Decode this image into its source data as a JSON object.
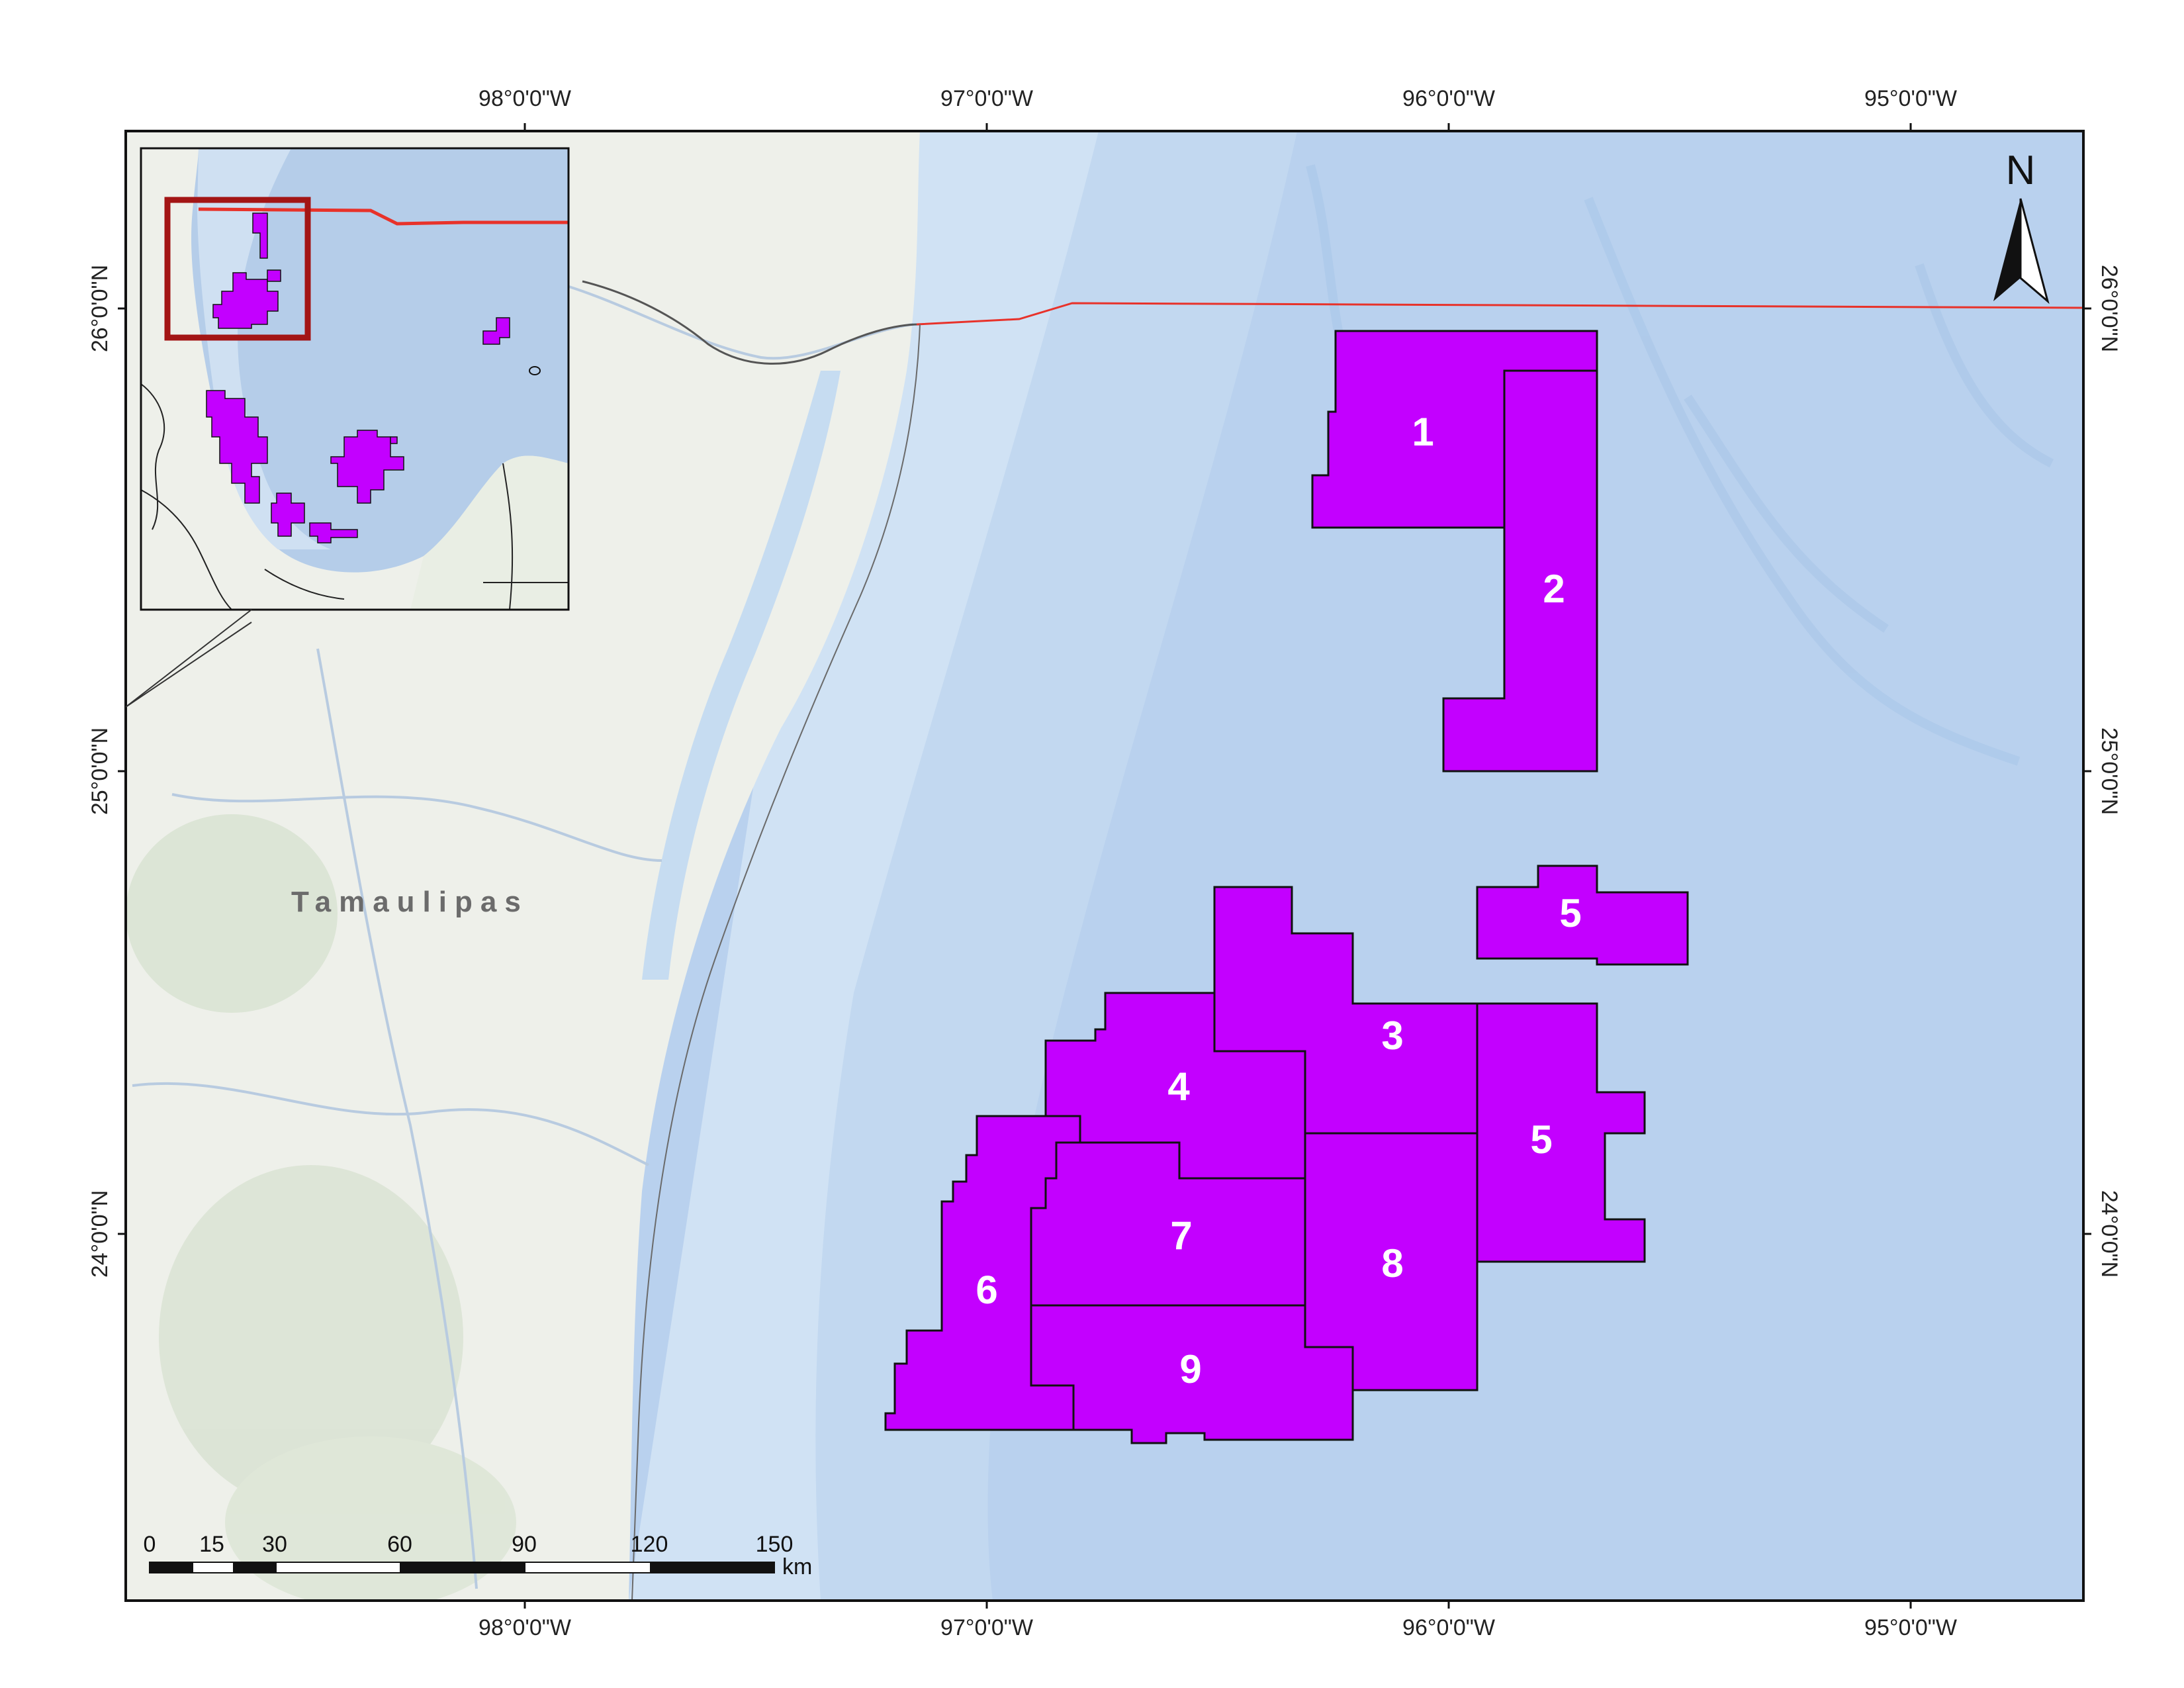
{
  "graticule": {
    "longitudes": [
      "98°0'0\"W",
      "97°0'0\"W",
      "96°0'0\"W",
      "95°0'0\"W"
    ],
    "latitudes": [
      "26°0'0\"N",
      "25°0'0\"N",
      "24°0'0\"N"
    ]
  },
  "place_labels": {
    "tamaulipas": "Tamaulipas"
  },
  "blocks": {
    "b1": "1",
    "b2": "2",
    "b3": "3",
    "b4": "4",
    "b5a": "5",
    "b5b": "5",
    "b6": "6",
    "b7": "7",
    "b8": "8",
    "b9": "9"
  },
  "scale_bar": {
    "ticks": [
      "0",
      "15",
      "30",
      "60",
      "90",
      "120",
      "150"
    ],
    "unit": "km"
  },
  "north_arrow": {
    "label": "N"
  },
  "colors": {
    "block_fill": "#c300ff",
    "land": "#eef0ea",
    "sea_shelf": "#cfe1f3",
    "sea_deep": "#b7d0ee",
    "boundary": "#e8322a",
    "inset_frame": "#a31515"
  }
}
